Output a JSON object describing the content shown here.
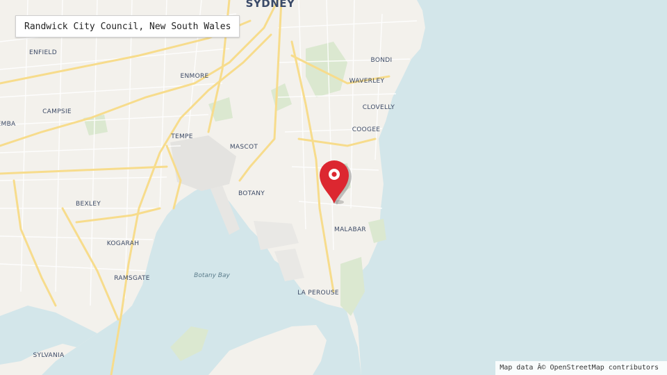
{
  "title": "Randwick City Council, New South Wales",
  "attribution": "Map data Â© OpenStreetMap contributors",
  "colors": {
    "land": "#f3f1ec",
    "water": "#d3e6ea",
    "park": "#dbe8d0",
    "major_road": "#f7dc8c",
    "minor_road": "#ffffff",
    "pin": "#dc2730"
  },
  "marker": {
    "icon": "map-pin-icon",
    "label": "Randwick City Council"
  },
  "places": {
    "sydney": "SYDNEY",
    "enfield": "ENFIELD",
    "enmore": "ENMORE",
    "campsie": "CAMPSIE",
    "emba": "EMBA",
    "tempe": "TEMPE",
    "mascot": "MASCOT",
    "botany": "BOTANY",
    "bexley": "BEXLEY",
    "kogarah": "KOGARAH",
    "ramsgate": "RAMSGATE",
    "sylvania": "SYLVANIA",
    "bondi": "BONDI",
    "waverley": "WAVERLEY",
    "clovelly": "CLOVELLY",
    "coogee": "COOGEE",
    "malabar": "MALABAR",
    "la_perouse": "LA PEROUSE",
    "botany_bay": "Botany Bay"
  }
}
